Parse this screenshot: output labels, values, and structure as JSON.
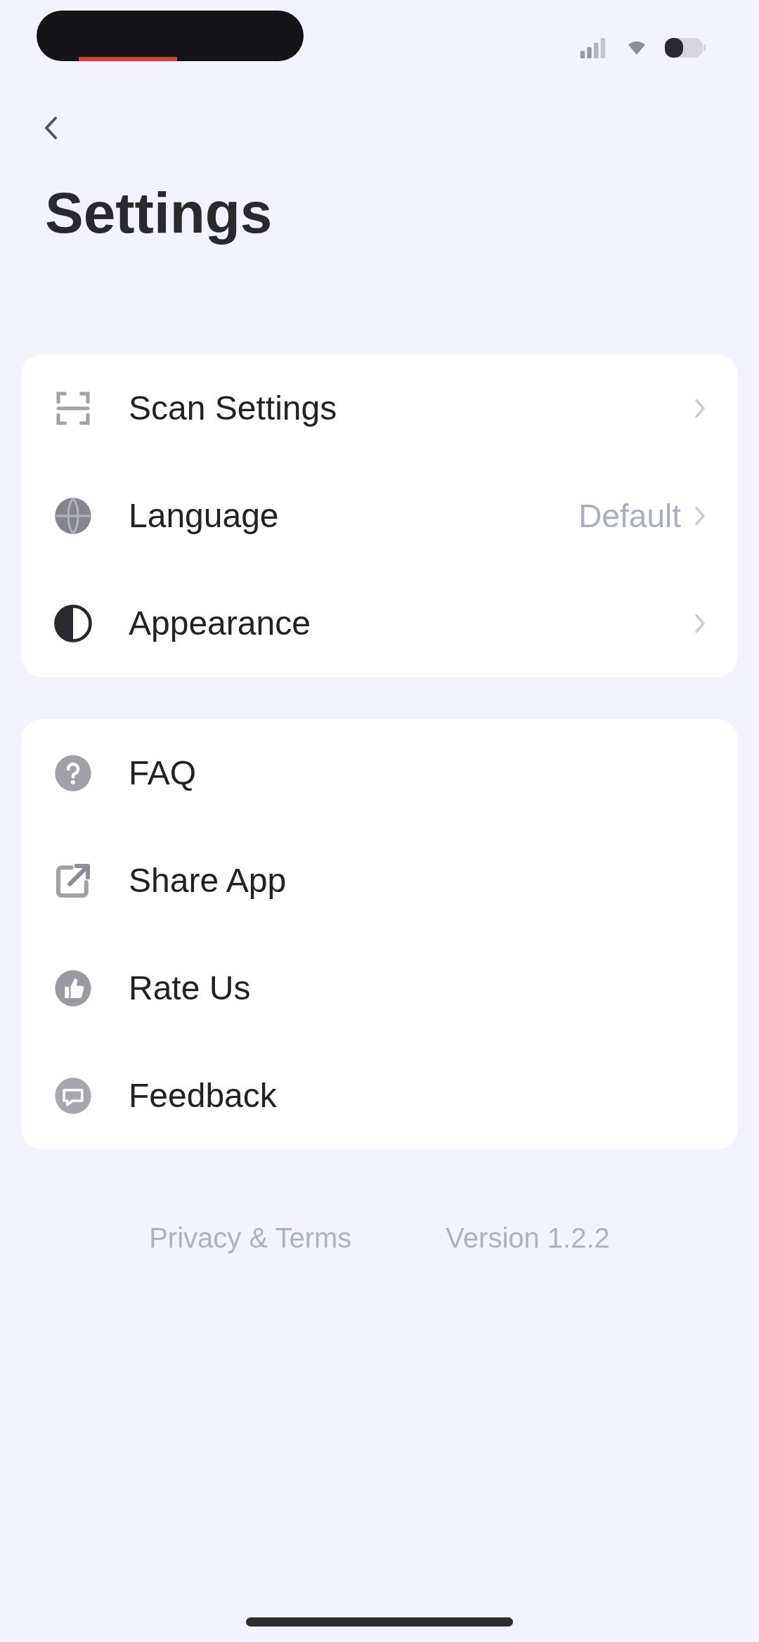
{
  "header": {
    "title": "Settings"
  },
  "groups": [
    {
      "items": [
        {
          "kind": "scan",
          "label": "Scan Settings",
          "chevron": true
        },
        {
          "kind": "language",
          "label": "Language",
          "value": "Default",
          "chevron": true
        },
        {
          "kind": "appearance",
          "label": "Appearance",
          "chevron": true
        }
      ]
    },
    {
      "items": [
        {
          "kind": "faq",
          "label": "FAQ",
          "chevron": false
        },
        {
          "kind": "share",
          "label": "Share App",
          "chevron": false
        },
        {
          "kind": "rate",
          "label": "Rate Us",
          "chevron": false
        },
        {
          "kind": "feedback",
          "label": "Feedback",
          "chevron": false
        }
      ]
    }
  ],
  "footer": {
    "link": "Privacy & Terms",
    "version": "Version 1.2.2"
  }
}
